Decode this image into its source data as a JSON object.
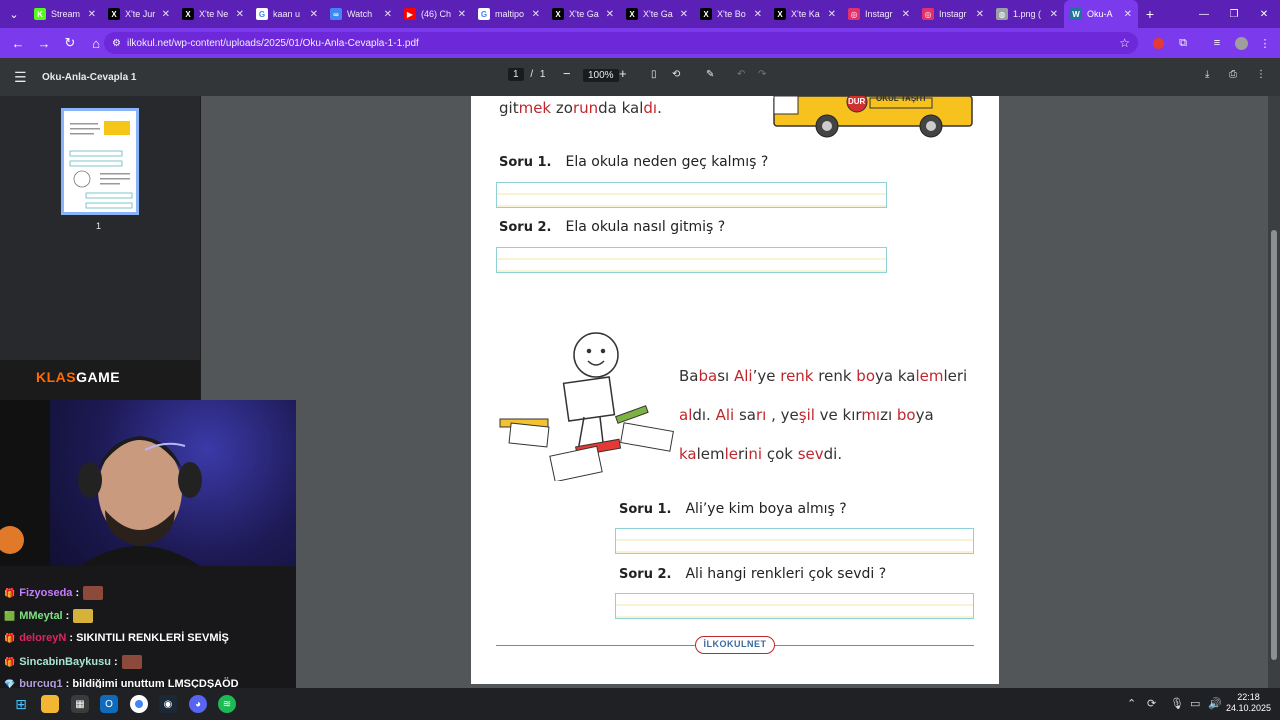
{
  "tabs": [
    {
      "label": "Stream",
      "icon": "kick-icon",
      "color": "#53fc18",
      "glyph": "K"
    },
    {
      "label": "X'te Jur",
      "icon": "x-icon",
      "color": "#000000",
      "glyph": "X"
    },
    {
      "label": "X'te Ne",
      "icon": "x-icon",
      "color": "#000000",
      "glyph": "X"
    },
    {
      "label": "kaan u",
      "icon": "google-icon",
      "color": "#ffffff",
      "glyph": "G"
    },
    {
      "label": "Watch",
      "icon": "globe-icon",
      "color": "#4285f4",
      "glyph": "∞"
    },
    {
      "label": "(46) Ch",
      "icon": "youtube-icon",
      "color": "#ff0000",
      "glyph": "▶"
    },
    {
      "label": "maltipo",
      "icon": "google-icon",
      "color": "#ffffff",
      "glyph": "G"
    },
    {
      "label": "X'te Ga",
      "icon": "x-icon",
      "color": "#000000",
      "glyph": "X"
    },
    {
      "label": "X'te Ga",
      "icon": "x-icon",
      "color": "#000000",
      "glyph": "X"
    },
    {
      "label": "X'te Bo",
      "icon": "x-icon",
      "color": "#000000",
      "glyph": "X"
    },
    {
      "label": "X'te Ka",
      "icon": "x-icon",
      "color": "#000000",
      "glyph": "X"
    },
    {
      "label": "Instagr",
      "icon": "instagram-icon",
      "color": "#e1306c",
      "glyph": "◎"
    },
    {
      "label": "Instagr",
      "icon": "instagram-icon",
      "color": "#e1306c",
      "glyph": "◎"
    },
    {
      "label": "1.png (",
      "icon": "globe-icon",
      "color": "#9aa0a6",
      "glyph": "◍"
    },
    {
      "label": "Oku-A",
      "icon": "wordpress-icon",
      "color": "#21759b",
      "glyph": "W",
      "active": true
    }
  ],
  "address": {
    "url": "ilkokul.net/wp-content/uploads/2025/01/Oku-Anla-Cevapla-1-1.pdf"
  },
  "pdf": {
    "title": "Oku-Anla-Cevapla 1",
    "page_current": "1",
    "page_sep": "/",
    "page_total": "1",
    "zoom": "100%",
    "thumb_number": "1"
  },
  "document": {
    "top_line_parts": [
      [
        "git",
        ""
      ],
      [
        "mek",
        "r"
      ],
      [
        " zo",
        ""
      ],
      [
        "run",
        "r"
      ],
      [
        "da kal",
        ""
      ],
      [
        "dı",
        "r"
      ],
      [
        ".",
        ""
      ]
    ],
    "bus_sign": "DUR",
    "bus_text": "OKUL TAŞITI",
    "q1_label": "Soru 1.",
    "q1_text": "Ela okula neden geç kalmış ?",
    "q2_label": "Soru 2.",
    "q2_text": "Ela okula nasıl gitmiş ?",
    "story_lines": [
      [
        [
          "Ba",
          ""
        ],
        [
          "ba",
          "r"
        ],
        [
          "sı ",
          ""
        ],
        [
          "Ali",
          "r"
        ],
        [
          "’ye ",
          ""
        ],
        [
          "renk",
          "r"
        ],
        [
          " renk ",
          ""
        ],
        [
          "bo",
          "r"
        ],
        [
          "ya ka",
          ""
        ],
        [
          "lem",
          "r"
        ],
        [
          "leri",
          ""
        ]
      ],
      [
        [
          "al",
          "r"
        ],
        [
          "dı. ",
          ""
        ],
        [
          "Ali",
          "r"
        ],
        [
          " sa",
          ""
        ],
        [
          "rı",
          "r"
        ],
        [
          " , ye",
          ""
        ],
        [
          "şil",
          "r"
        ],
        [
          " ve kır",
          ""
        ],
        [
          "mı",
          "r"
        ],
        [
          "zı ",
          ""
        ],
        [
          "bo",
          "r"
        ],
        [
          "ya",
          ""
        ]
      ],
      [
        [
          "ka",
          "r"
        ],
        [
          "lem",
          ""
        ],
        [
          "le",
          "r"
        ],
        [
          "ri",
          ""
        ],
        [
          "ni",
          "r"
        ],
        [
          " çok ",
          ""
        ],
        [
          "sev",
          "r"
        ],
        [
          "di.",
          ""
        ]
      ]
    ],
    "q3_label": "Soru 1.",
    "q3_text": "Ali’ye kim boya almış ?",
    "q4_label": "Soru 2.",
    "q4_text": "Ali hangi renkleri çok sevdi ?",
    "footer_logo": "İLKOKULNET"
  },
  "stream": {
    "logo_orange": "KLAS",
    "logo_white": "GAME"
  },
  "chat": [
    {
      "user": "Fizyoseda",
      "user_color": "#c77dff",
      "sep": " :",
      "message": "",
      "badge": "🎁",
      "emote": "#8c4a3a"
    },
    {
      "user": "MMeytal",
      "user_color": "#7ee081",
      "sep": " :",
      "message": "",
      "badge": "🟩",
      "emote": "#d6b23a"
    },
    {
      "user": "deloreyN",
      "user_color": "#e0245e",
      "sep": " :",
      "message": " SIKINTILI RENKLERİ SEVMİŞ",
      "badge": "🎁",
      "emote": ""
    },
    {
      "user": "SincabinBaykusu",
      "user_color": "#a8e6cf",
      "sep": " :",
      "message": "",
      "badge": "🎁",
      "emote": "#8c4a3a"
    },
    {
      "user": "burcuq1",
      "user_color": "#b39ddb",
      "sep": " :",
      "message": " bildiğimi unuttum LMSÇDŞAÖD",
      "badge": "💎",
      "emote": ""
    }
  ],
  "taskbar": {
    "time": "22:18",
    "date": "24.10.2025"
  }
}
